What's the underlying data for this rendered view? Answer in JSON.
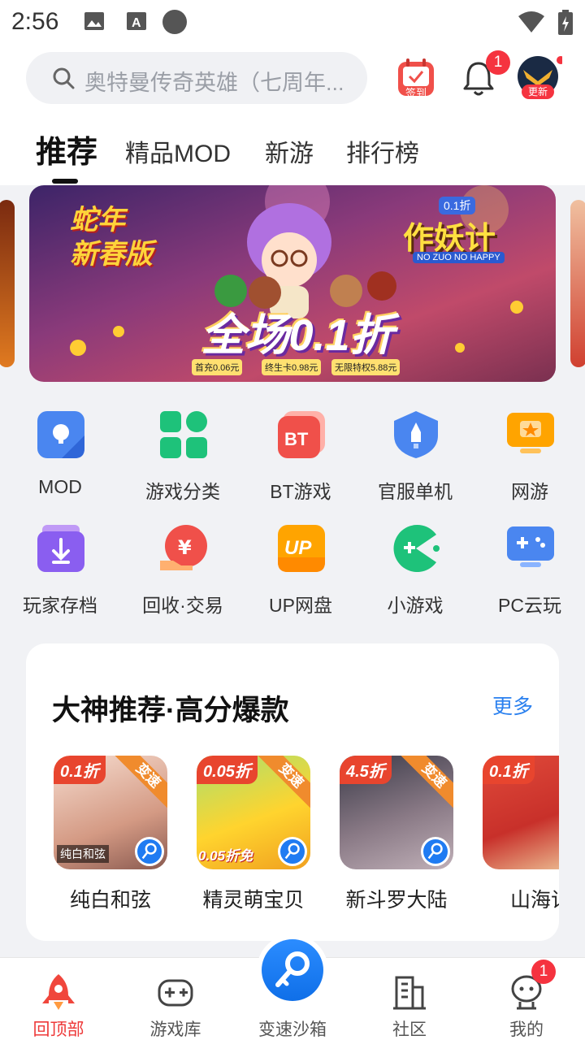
{
  "status_bar": {
    "time": "2:56",
    "icons": [
      "image-icon",
      "text-a-icon",
      "circle-dot-icon",
      "wifi-icon",
      "battery-charging-icon"
    ]
  },
  "header": {
    "search_placeholder": "奥特曼传奇英雄（七周年...",
    "checkin_label": "签到",
    "notification_count": "1",
    "avatar_label": "更新"
  },
  "tabs": [
    {
      "label": "推荐",
      "active": true
    },
    {
      "label": "精品MOD"
    },
    {
      "label": "新游"
    },
    {
      "label": "排行榜"
    }
  ],
  "banner": {
    "corner_text": "蛇年\n新春版",
    "logo_top": "0.1折",
    "logo_main": "作妖计",
    "logo_sub": "NO ZUO NO HAPPY",
    "headline": "全场0.1折",
    "perks": [
      "首充0.06元",
      "终生卡0.98元",
      "无限特权5.88元"
    ]
  },
  "quick_links": [
    {
      "label": "MOD",
      "icon": "mod-icon"
    },
    {
      "label": "游戏分类",
      "icon": "category-grid-icon"
    },
    {
      "label": "BT游戏",
      "icon": "bt-icon"
    },
    {
      "label": "官服单机",
      "icon": "shield-rocket-icon"
    },
    {
      "label": "网游",
      "icon": "monitor-star-icon"
    },
    {
      "label": "玩家存档",
      "icon": "save-download-icon"
    },
    {
      "label": "回收·交易",
      "icon": "recycle-trade-icon"
    },
    {
      "label": "UP网盘",
      "icon": "up-cloud-icon"
    },
    {
      "label": "小游戏",
      "icon": "mini-game-icon"
    },
    {
      "label": "PC云玩",
      "icon": "pc-gamepad-icon"
    }
  ],
  "recommend": {
    "title": "大神推荐·高分爆款",
    "more": "更多",
    "games": [
      {
        "name": "纯白和弦",
        "discount": "0.1折",
        "ribbon": "变速",
        "caption": "纯白和弦",
        "color": "#e9b8a0"
      },
      {
        "name": "精灵萌宝贝",
        "discount": "0.05折",
        "ribbon": "变速",
        "caption": "0.05折免",
        "color": "#ffd42e"
      },
      {
        "name": "新斗罗大陆",
        "discount": "4.5折",
        "ribbon": "变速",
        "caption": "",
        "color": "#6b5a66"
      },
      {
        "name": "山海记",
        "discount": "0.1折",
        "ribbon": "",
        "caption": "",
        "color": "#c8302a"
      }
    ]
  },
  "bottom_nav": [
    {
      "label": "回顶部",
      "active": true
    },
    {
      "label": "游戏库"
    },
    {
      "label": "变速沙箱"
    },
    {
      "label": "社区"
    },
    {
      "label": "我的",
      "badge": "1"
    }
  ],
  "colors": {
    "accent": "#2a80ef",
    "badge": "#f5333f",
    "active_nav": "#ee3a3a"
  }
}
